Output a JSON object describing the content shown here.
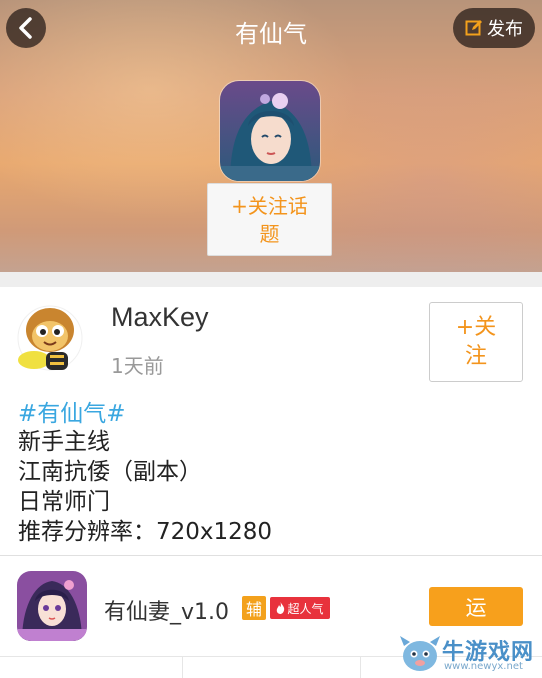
{
  "header": {
    "title": "有仙气",
    "publish_label": "发布",
    "follow_topic_label": "+关注话题",
    "icons": {
      "back": "chevron-left-icon",
      "publish": "edit-icon"
    }
  },
  "post": {
    "username": "MaxKey",
    "time": "1天前",
    "follow_label": "+关注",
    "topic_tag": "#有仙气#",
    "lines": [
      "新手主线",
      "江南抗倭（副本）",
      "日常师门",
      "推荐分辨率：720x1280"
    ]
  },
  "app": {
    "name": "有仙妻_v1.0",
    "badge_aux": "辅",
    "badge_hot": "超人气",
    "run_label": "运"
  },
  "watermark": {
    "title": "牛游戏网",
    "url": "www.newyx.net"
  },
  "colors": {
    "accent_orange": "#f3941c",
    "topic_blue": "#3aa7e0",
    "hot_red": "#e8323c"
  }
}
